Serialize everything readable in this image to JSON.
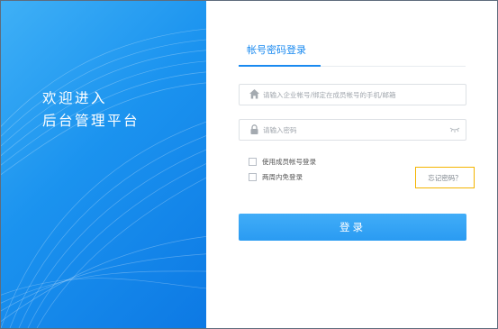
{
  "welcome": {
    "line1": "欢迎进入",
    "line2": "后台管理平台"
  },
  "login": {
    "tab_label": "帐号密码登录",
    "account_placeholder": "请输入企业帐号/绑定在成员帐号的手机/邮箱",
    "password_placeholder": "请输入密码",
    "member_login_label": "使用成员帐号登录",
    "remember_label": "两周内免登录",
    "forgot_label": "忘记密码？",
    "submit_label": "登录"
  },
  "icons": {
    "account": "home-icon",
    "password": "lock-icon",
    "eye": "eye-closed-icon"
  },
  "colors": {
    "accent": "#1a8af0",
    "panel": "#1b93ef",
    "highlight": "#f4b400"
  }
}
